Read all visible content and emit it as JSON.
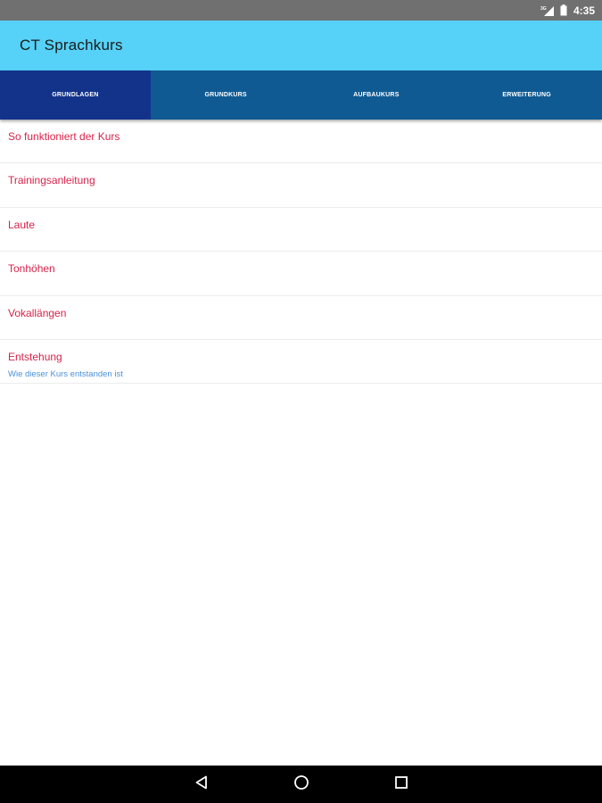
{
  "status_bar": {
    "signal_label": "3G",
    "time": "4:35",
    "icons": [
      "signal-icon",
      "battery-icon"
    ]
  },
  "app_bar": {
    "title": "CT Sprachkurs",
    "background": "#56d1f7"
  },
  "tabs": [
    {
      "label": "GRUNDLAGEN",
      "active": true
    },
    {
      "label": "GRUNDKURS",
      "active": false
    },
    {
      "label": "AUFBAUKURS",
      "active": false
    },
    {
      "label": "ERWEITERUNG",
      "active": false
    }
  ],
  "colors": {
    "tab_bar": "#0f5a93",
    "tab_active": "#13338a",
    "item_title": "#d8224a",
    "item_subtitle": "#4a90d9"
  },
  "list_items": [
    {
      "title": "So funktioniert der Kurs",
      "subtitle": ""
    },
    {
      "title": "Trainingsanleitung",
      "subtitle": ""
    },
    {
      "title": "Laute",
      "subtitle": ""
    },
    {
      "title": "Tonhöhen",
      "subtitle": ""
    },
    {
      "title": "Vokallängen",
      "subtitle": ""
    },
    {
      "title": "Entstehung",
      "subtitle": "Wie dieser Kurs entstanden ist"
    }
  ],
  "nav_bar": {
    "icons": [
      "back-icon",
      "home-icon",
      "recents-icon"
    ]
  }
}
